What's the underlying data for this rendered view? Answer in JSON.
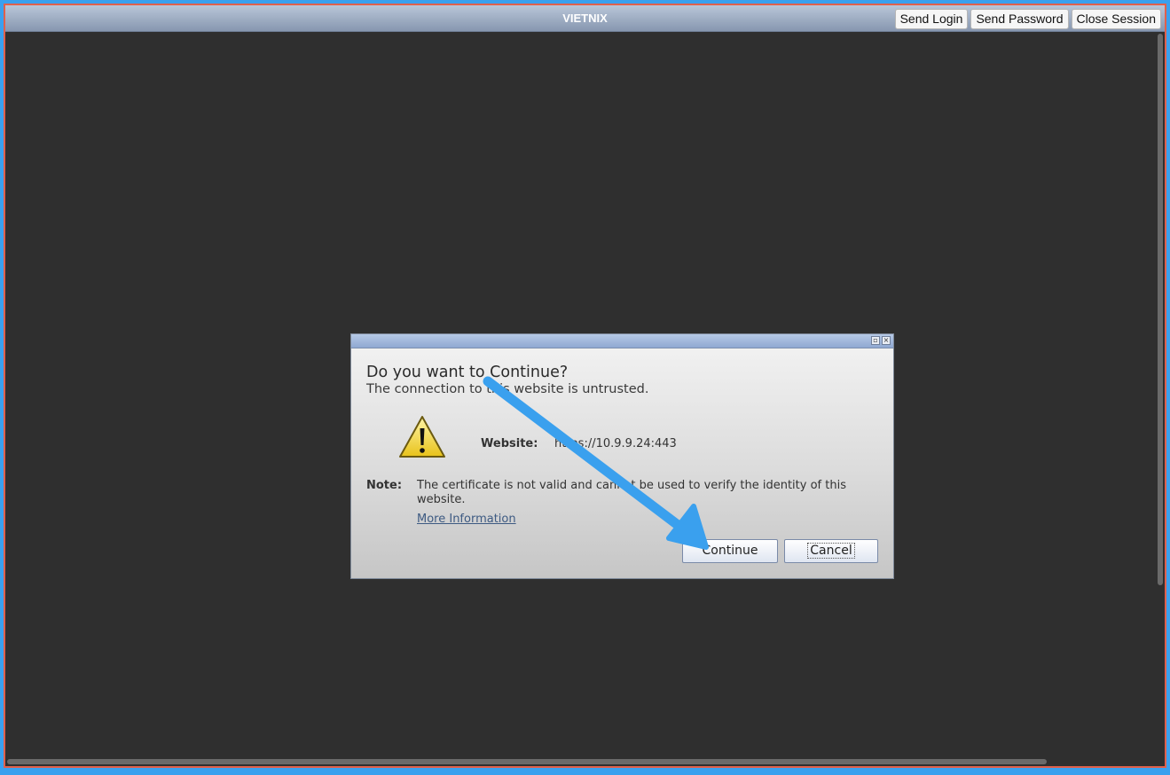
{
  "window": {
    "title": "VIETNIX",
    "buttons": [
      "Send Login",
      "Send Password",
      "Close Session"
    ]
  },
  "dialog": {
    "heading": "Do you want to Continue?",
    "subheading": "The connection to this website is untrusted.",
    "website_label": "Website:",
    "website_value": "https://10.9.9.24:443",
    "note_label": "Note:",
    "note_text": "The certificate is not valid and cannot be used to verify the identity of this website.",
    "more_info": "More Information",
    "continue_label": "Continue",
    "cancel_label": "Cancel"
  },
  "annotation": {
    "arrow_color": "#3aa0ee",
    "points_to": "continue-button"
  },
  "colors": {
    "frame_border": "#e0604c",
    "background": "#2f2f2f",
    "accent": "#3aa0ee"
  }
}
